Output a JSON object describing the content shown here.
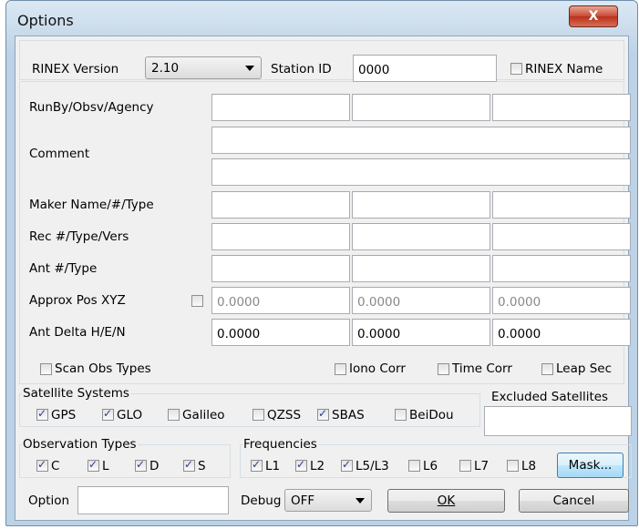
{
  "window": {
    "title": "Options",
    "close_glyph": "X"
  },
  "header": {
    "rinex_version_label": "RINEX Version",
    "rinex_version_value": "2.10",
    "station_id_label": "Station ID",
    "station_id_value": "0000",
    "rinex_name_label": "RINEX Name",
    "rinex_name_checked": false
  },
  "rows": {
    "runby_label": "RunBy/Obsv/Agency",
    "comment_label": "Comment",
    "maker_label": "Maker Name/#/Type",
    "rec_label": "Rec #/Type/Vers",
    "ant_label": "Ant #/Type",
    "approx_label": "Approx Pos XYZ",
    "approx_checked": false,
    "approx_values": [
      "0.0000",
      "0.0000",
      "0.0000"
    ],
    "delta_label": "Ant Delta H/E/N",
    "delta_values": [
      "0.0000",
      "0.0000",
      "0.0000"
    ]
  },
  "checks": {
    "scan_obs": {
      "label": "Scan Obs Types",
      "checked": false
    },
    "iono": {
      "label": "Iono Corr",
      "checked": false
    },
    "time": {
      "label": "Time Corr",
      "checked": false
    },
    "leap": {
      "label": "Leap Sec",
      "checked": false
    }
  },
  "satellite_systems": {
    "title": "Satellite Systems",
    "items": [
      {
        "label": "GPS",
        "checked": true
      },
      {
        "label": "GLO",
        "checked": true
      },
      {
        "label": "Galileo",
        "checked": false
      },
      {
        "label": "QZSS",
        "checked": false
      },
      {
        "label": "SBAS",
        "checked": true
      },
      {
        "label": "BeiDou",
        "checked": false
      }
    ]
  },
  "excluded": {
    "label": "Excluded Satellites",
    "value": ""
  },
  "observation_types": {
    "title": "Observation Types",
    "items": [
      {
        "label": "C",
        "checked": true
      },
      {
        "label": "L",
        "checked": true
      },
      {
        "label": "D",
        "checked": true
      },
      {
        "label": "S",
        "checked": true
      }
    ]
  },
  "frequencies": {
    "title": "Frequencies",
    "items": [
      {
        "label": "L1",
        "checked": true
      },
      {
        "label": "L2",
        "checked": true
      },
      {
        "label": "L5/L3",
        "checked": true
      },
      {
        "label": "L6",
        "checked": false
      },
      {
        "label": "L7",
        "checked": false
      },
      {
        "label": "L8",
        "checked": false
      }
    ],
    "mask_label": "Mask..."
  },
  "footer": {
    "option_label": "Option",
    "option_value": "",
    "debug_label": "Debug",
    "debug_value": "OFF",
    "ok_label": "OK",
    "cancel_label": "Cancel"
  }
}
